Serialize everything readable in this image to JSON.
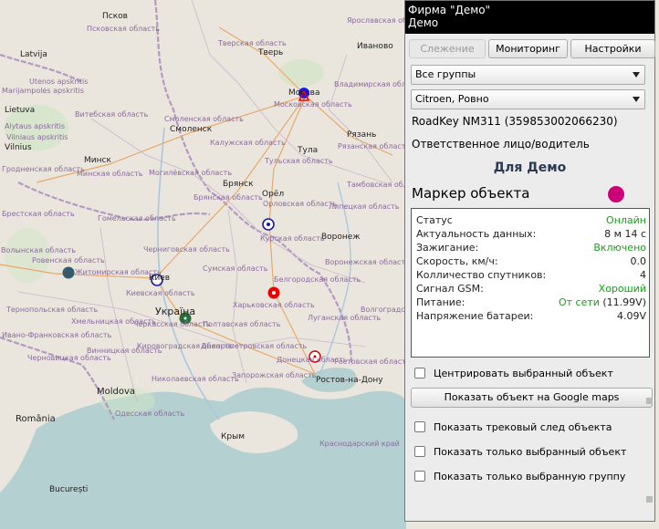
{
  "map": {
    "cities": [
      {
        "name": "Псков",
        "id": "pskov"
      },
      {
        "name": "Тверь",
        "id": "tver"
      },
      {
        "name": "Иваново",
        "id": "ivanovo"
      },
      {
        "name": "Москва",
        "id": "moskva"
      },
      {
        "name": "Смоленск",
        "id": "smolensk"
      },
      {
        "name": "Рязань",
        "id": "ryazan"
      },
      {
        "name": "Тула",
        "id": "tula"
      },
      {
        "name": "Минск",
        "id": "minsk"
      },
      {
        "name": "Брянск",
        "id": "bryansk"
      },
      {
        "name": "Орёл",
        "id": "orel"
      },
      {
        "name": "Воронеж",
        "id": "voronezh"
      },
      {
        "name": "Киев",
        "id": "kiev"
      },
      {
        "name": "Україна",
        "id": "ukraina"
      },
      {
        "name": "Ростов-на-Дону",
        "id": "rostov"
      },
      {
        "name": "Крым",
        "id": "krym"
      },
      {
        "name": "Moldova",
        "id": "moldova"
      },
      {
        "name": "România",
        "id": "romania"
      },
      {
        "name": "București",
        "id": "bucuresti"
      },
      {
        "name": "Latvija",
        "id": "latvija"
      },
      {
        "name": "Lietuva",
        "id": "lietuva"
      },
      {
        "name": "Vilnius",
        "id": "vilnius"
      }
    ],
    "regions": [
      "Псковская область",
      "Тверская область",
      "Ярославская область",
      "Московская область",
      "Владимирская область",
      "Смоленская область",
      "Калужская область",
      "Рязанская область",
      "Тульская область",
      "Витебская область",
      "Минская область",
      "Могилёвская область",
      "Гродненская область",
      "Брестская область",
      "Гомельская область",
      "Брянская область",
      "Орловская область",
      "Липецкая область",
      "Тамбовская область",
      "Курская область",
      "Воронежская область",
      "Черниговская область",
      "Сумская область",
      "Волынская область",
      "Ровенская область",
      "Житомирская область",
      "Киевская область",
      "Харьковская область",
      "Луганская область",
      "Тернопольская область",
      "Хмельницкая область",
      "Черкасская область",
      "Полтавская область",
      "Кировоградская область",
      "Днепропетровская область",
      "Донецкая область",
      "Запорожская область",
      "Николаевская область",
      "Одесская область",
      "Ростовская область",
      "Краснодарский край",
      "Белгородская область",
      "Винницкая область",
      "Ивано-Франковская область",
      "Черновицкая область",
      "Utenos apskritis",
      "Vilniaus apskritis",
      "Alytaus apskritis",
      "Marijampolės apskritis",
      "Волгоградская область"
    ]
  },
  "panel": {
    "header_line1": "Фирма \"Демо\"",
    "header_line2": "Демо",
    "tabs": [
      "Слежение",
      "Мониторинг",
      "Настройки"
    ],
    "group_select": "Все группы",
    "object_select": "Citroen, Ровно",
    "device": "RoadKey NM311 (359853002066230)",
    "responsible_label": "Ответственное лицо/водитель",
    "responsible_name": "Для Демо",
    "marker_label": "Маркер объекта",
    "marker_color": "#cc0077",
    "status_rows": [
      {
        "key": "Статус",
        "value": "Онлайн",
        "green": true
      },
      {
        "key": "Актуальность данных:",
        "value": "8 м 14 с",
        "green": false
      },
      {
        "key": "Зажигание:",
        "value": "Включено",
        "green": true
      },
      {
        "key": "Скорость, км/ч:",
        "value": "0.0",
        "green": false
      },
      {
        "key": "Колличество спутников:",
        "value": "4",
        "green": false
      },
      {
        "key": "Сигнал GSM:",
        "value": "Хороший",
        "green": true
      },
      {
        "key": "Питание:",
        "value": "От сети",
        "extra": "(11.99V)",
        "green": true
      },
      {
        "key": "Напряжение батареи:",
        "value": "4.09V",
        "green": false
      }
    ],
    "center_checkbox": "Центрировать выбранный объект",
    "google_button": "Показать объект на Google maps",
    "track_checkbox": "Показать трековый след объекта",
    "only_object_checkbox": "Показать только выбранный объект",
    "only_group_checkbox": "Показать только выбранную группу"
  }
}
